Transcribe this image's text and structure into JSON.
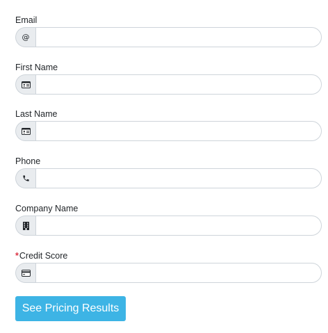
{
  "form": {
    "fields": [
      {
        "label": "Email",
        "required": false,
        "icon": "at-icon",
        "value": "",
        "placeholder": ""
      },
      {
        "label": "First Name",
        "required": false,
        "icon": "id-card-icon",
        "value": "",
        "placeholder": ""
      },
      {
        "label": "Last Name",
        "required": false,
        "icon": "id-card-icon",
        "value": "",
        "placeholder": ""
      },
      {
        "label": "Phone",
        "required": false,
        "icon": "phone-icon",
        "value": "",
        "placeholder": ""
      },
      {
        "label": "Company Name",
        "required": false,
        "icon": "building-icon",
        "value": "",
        "placeholder": ""
      },
      {
        "label": "Credit Score",
        "required": true,
        "icon": "credit-card-icon",
        "value": "",
        "placeholder": ""
      }
    ],
    "icon_text": {
      "at": "@"
    },
    "submit_label": "See Pricing Results"
  },
  "colors": {
    "button_bg": "#3db4e5",
    "required_mark": "#dc3545",
    "addon_bg": "#e9ecef",
    "border": "#ced4da"
  }
}
